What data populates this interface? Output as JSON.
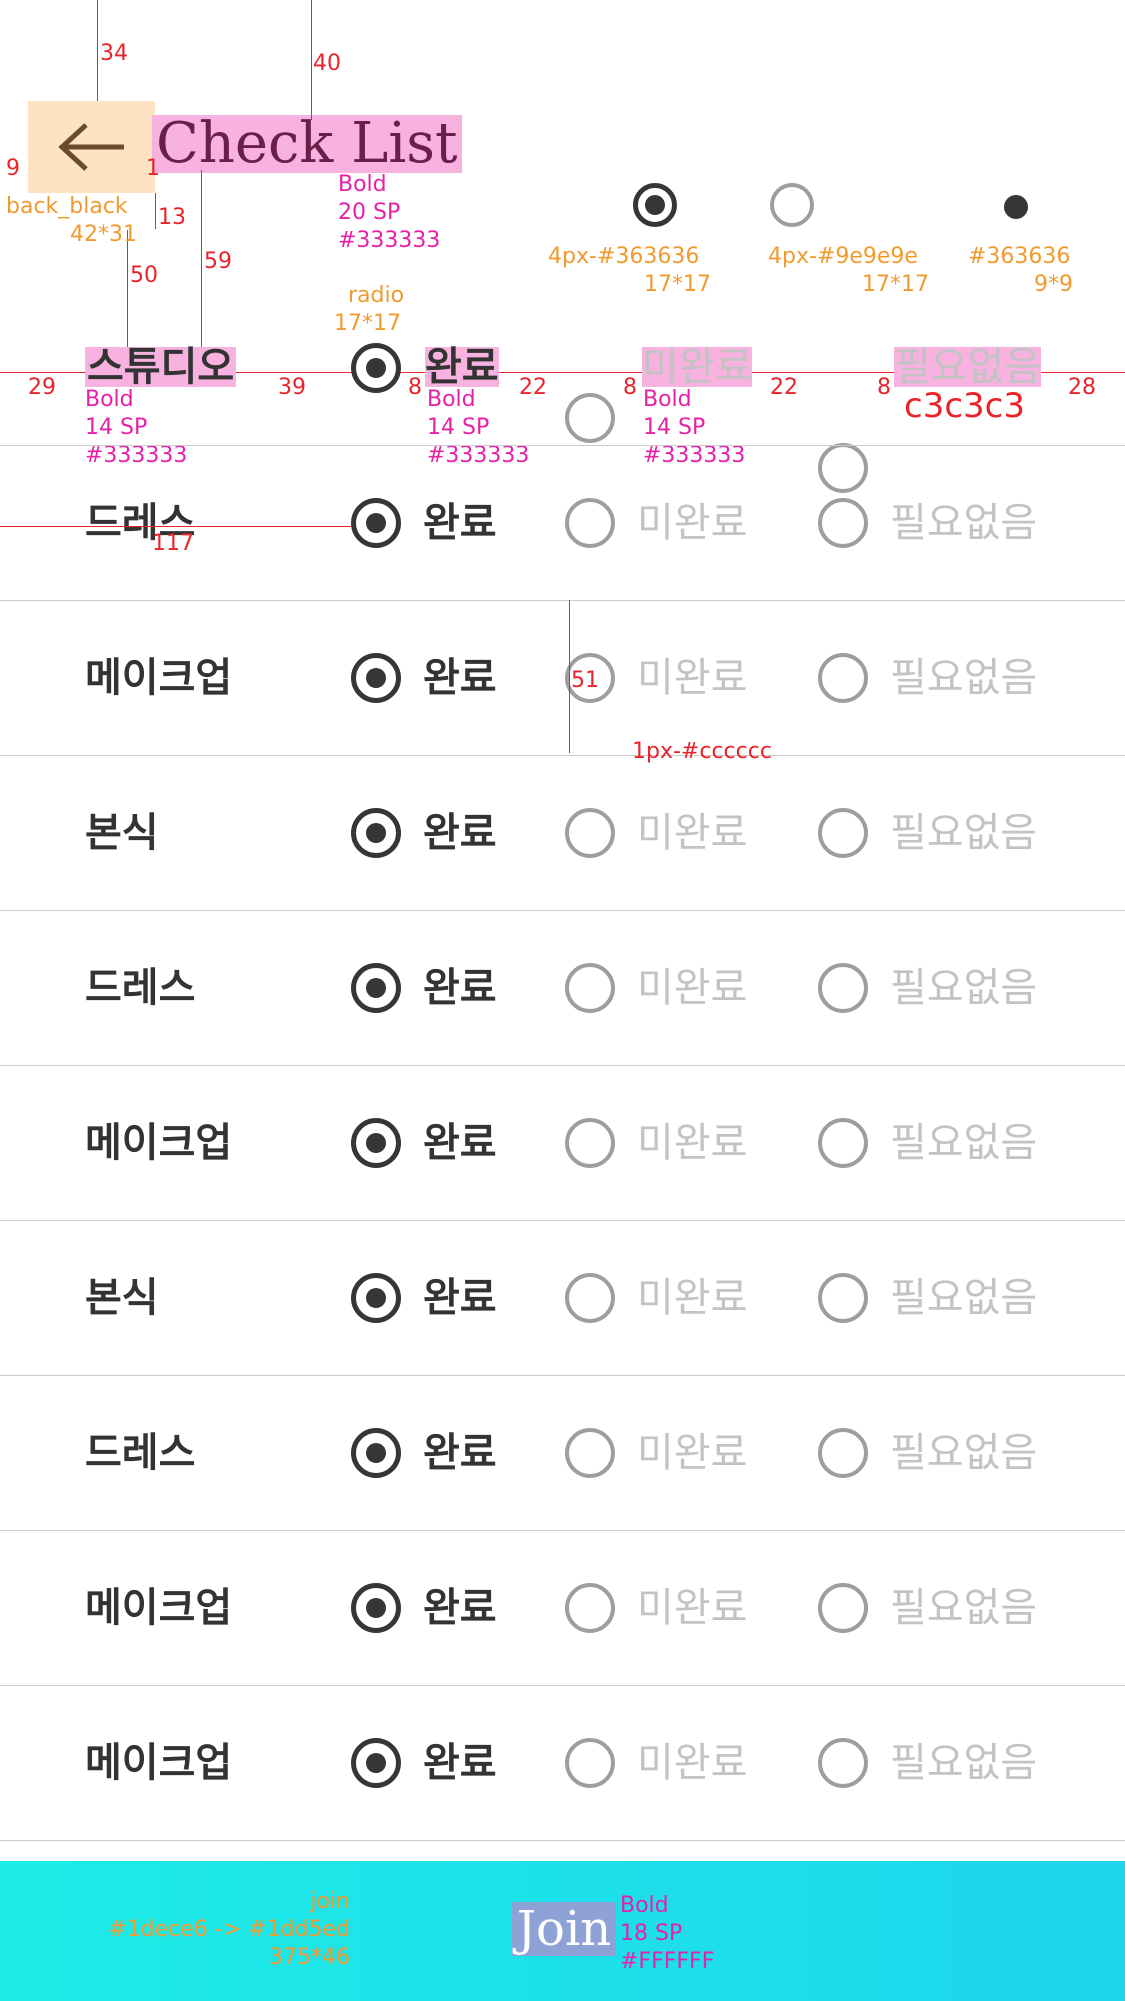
{
  "header": {
    "title": "Check List",
    "back_icon": "arrow-left-icon"
  },
  "legend": {
    "on": {
      "label": "4px-#363636",
      "size": "17*17"
    },
    "off": {
      "label": "4px-#9e9e9e",
      "size": "17*17"
    },
    "dot": {
      "label": "#363636",
      "size": "9*9"
    }
  },
  "columns": {
    "category": "스튜디오",
    "done": "완료",
    "not_done": "미완료",
    "not_needed": "필요없음"
  },
  "rows": [
    {
      "label": "드레스",
      "selected": "done"
    },
    {
      "label": "메이크업",
      "selected": "done"
    },
    {
      "label": "본식",
      "selected": "done"
    },
    {
      "label": "드레스",
      "selected": "done"
    },
    {
      "label": "메이크업",
      "selected": "done"
    },
    {
      "label": "본식",
      "selected": "done"
    },
    {
      "label": "드레스",
      "selected": "done"
    },
    {
      "label": "메이크업",
      "selected": "done"
    },
    {
      "label": "메이크업",
      "selected": "done"
    }
  ],
  "join": {
    "label": "Join"
  },
  "annotations": {
    "d34": "34",
    "d40": "40",
    "d9": "9",
    "d1": "1",
    "d13": "13",
    "d50": "50",
    "d59": "59",
    "back_name": "back_black",
    "back_size": "42*31",
    "title_spec": [
      "Bold",
      "20 SP",
      "#333333"
    ],
    "radio_name": "radio",
    "radio_size": "17*17",
    "d29": "29",
    "d39": "39",
    "d8a": "8",
    "d22a": "22",
    "d8b": "8",
    "d22b": "22",
    "d8c": "8",
    "d28": "28",
    "c3": "c3c3c3",
    "col_spec": [
      "Bold",
      "14 SP",
      "#333333"
    ],
    "d117": "117",
    "d51": "51",
    "divider": "1px-#cccccc",
    "join_spec": [
      "join",
      "#1dece6 -> #1dd5ed",
      "375*46"
    ],
    "join_text_spec": [
      "Bold",
      "18 SP",
      "#FFFFFF"
    ]
  },
  "colors": {
    "text": "#333333",
    "radio_on": "#363636",
    "radio_off": "#9e9e9e",
    "muted": "#c3c3c3",
    "divider": "#cccccc",
    "join_from": "#1dece6",
    "join_to": "#1dd5ed"
  }
}
